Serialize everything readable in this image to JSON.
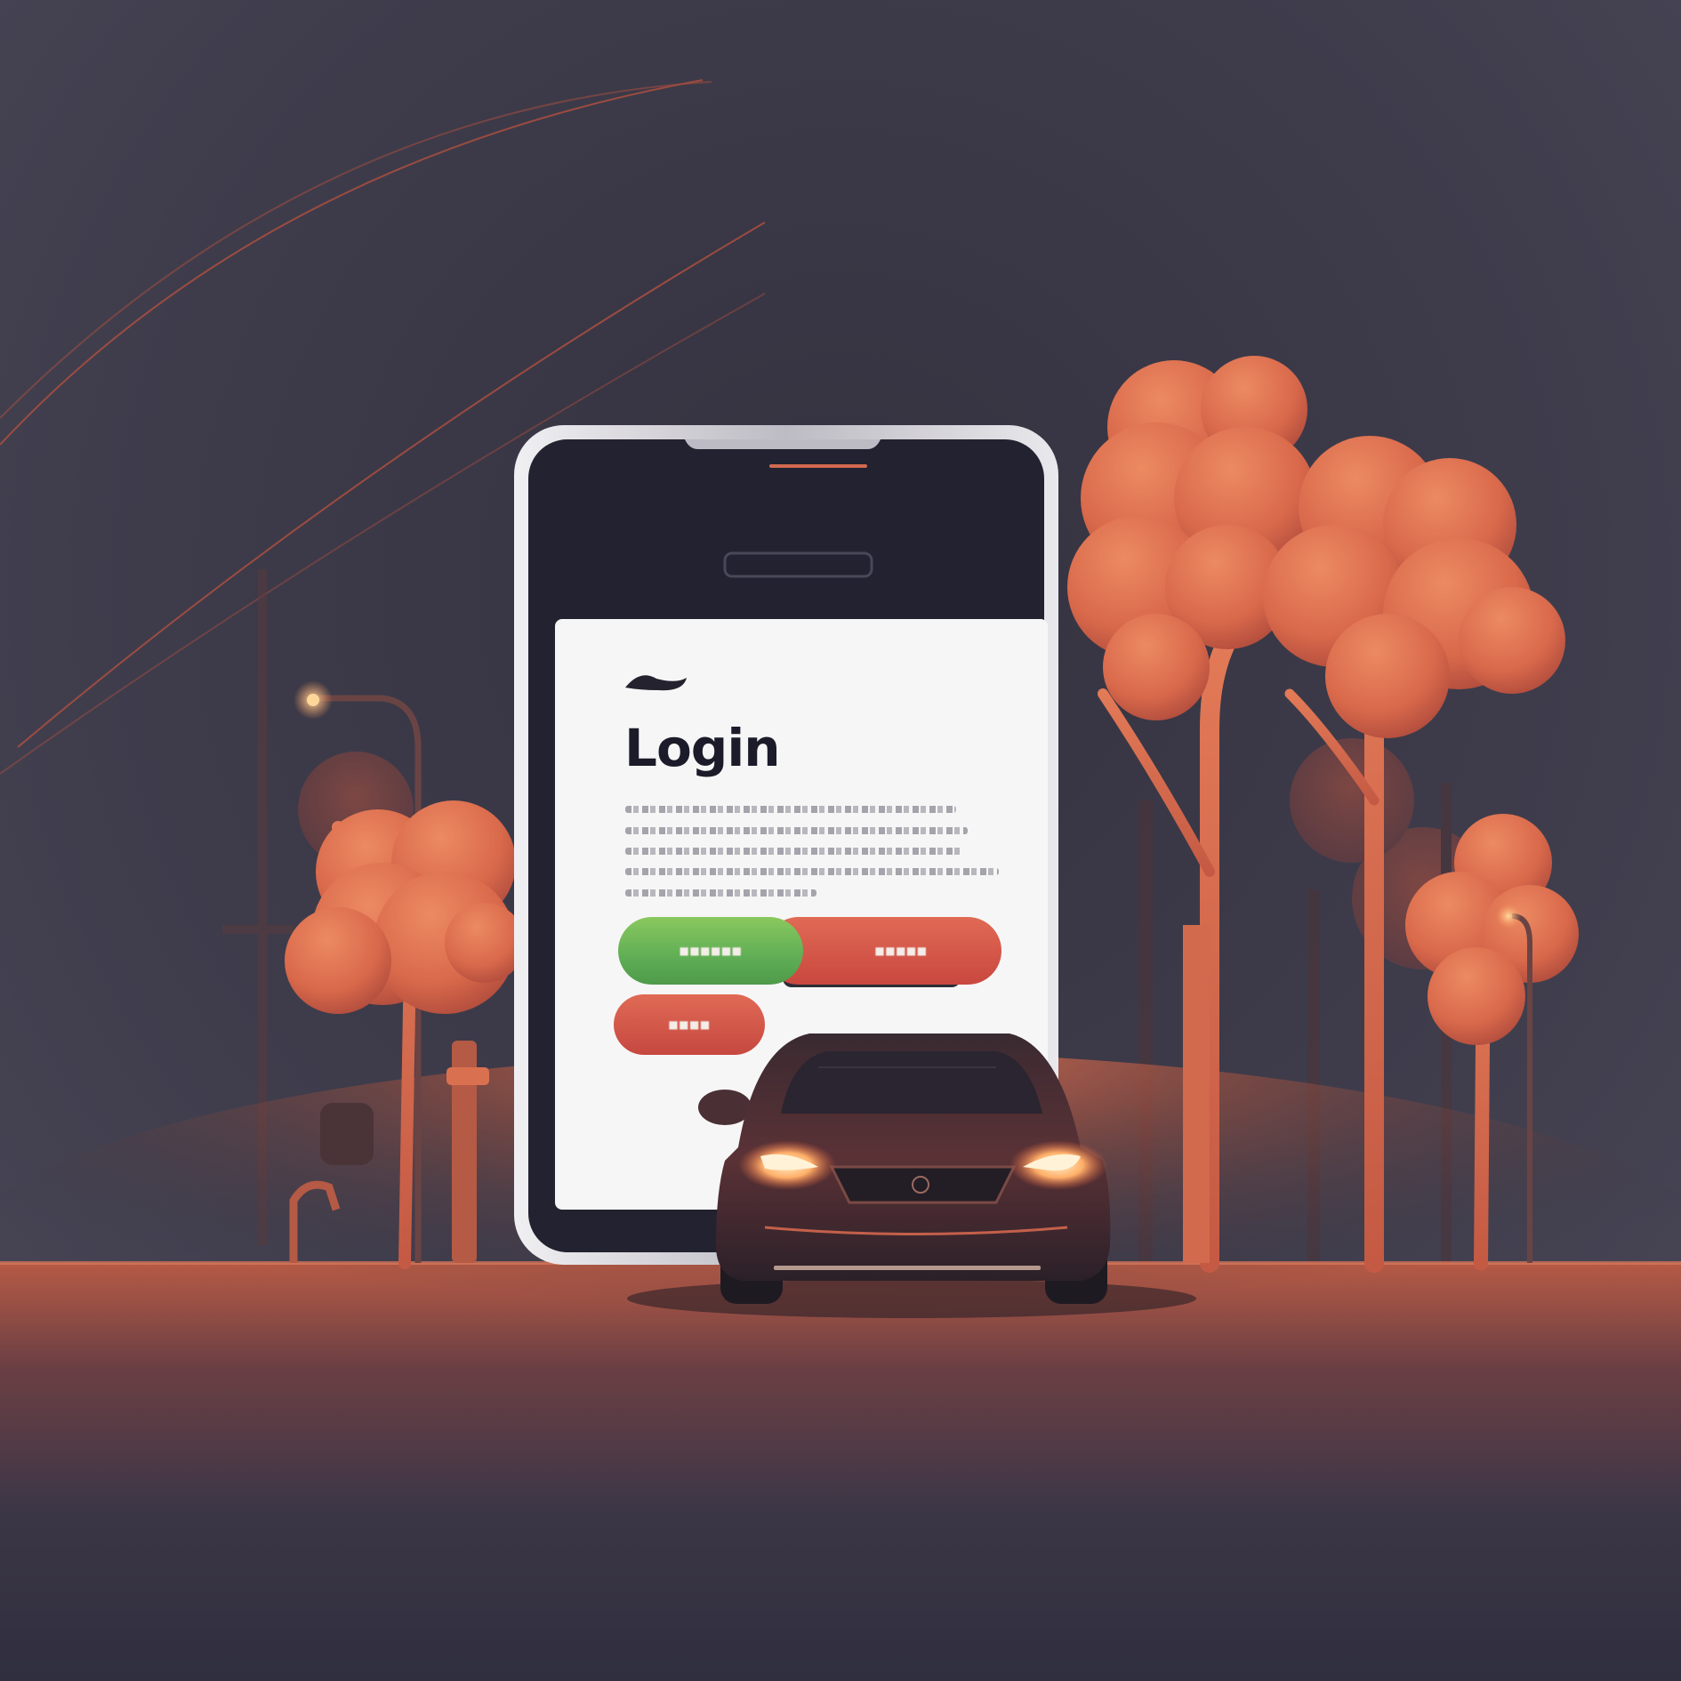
{
  "login": {
    "title": "Login"
  },
  "colors": {
    "sky": "#3c3b4a",
    "tree_orange": "#d9694b",
    "ground_glow": "#c8583f",
    "button_green": "#6bb558",
    "button_red": "#d05445",
    "screen_white": "#f7f6f6",
    "phone_frame": "#d9d8dc"
  },
  "icons": {
    "logo": "app-logo-swoosh-icon",
    "car": "car-icon",
    "street_lamp": "street-lamp-icon"
  }
}
